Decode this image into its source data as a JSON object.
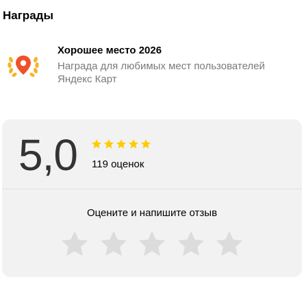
{
  "section": {
    "title": "Награды"
  },
  "award": {
    "icon": "laurel-map-pin-icon",
    "title": "Хорошее место 2026",
    "description": "Награда для любимых мест пользователей Яндекс Карт"
  },
  "rating": {
    "score": "5,0",
    "stars_filled": 5,
    "stars_total": 5,
    "review_count": "119 оценок",
    "cta": "Оцените и напишите отзыв",
    "rate_stars_count": 5
  },
  "colors": {
    "star_filled": "#FFCC00",
    "star_empty": "#DCDCDC",
    "pin": "#F0522A",
    "laurel": "#F5B324",
    "card_bg": "#F2F2F2"
  }
}
